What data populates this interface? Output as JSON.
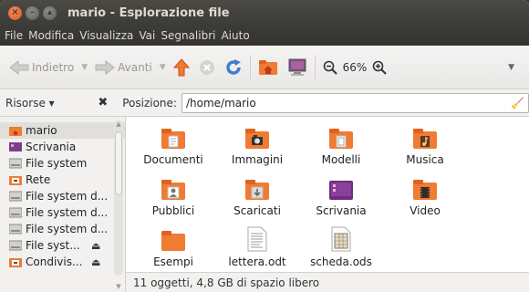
{
  "window": {
    "title": "mario - Esplorazione file"
  },
  "menubar": [
    "File",
    "Modifica",
    "Visualizza",
    "Vai",
    "Segnalibri",
    "Aiuto"
  ],
  "toolbar": {
    "back_label": "Indietro",
    "forward_label": "Avanti",
    "zoom_level": "66%"
  },
  "sidebar": {
    "header": "Risorse ▾",
    "items": [
      {
        "label": "mario",
        "icon": "home-folder-icon",
        "selected": true
      },
      {
        "label": "Scrivania",
        "icon": "desktop-icon"
      },
      {
        "label": "File system",
        "icon": "drive-icon"
      },
      {
        "label": "Rete",
        "icon": "network-icon"
      },
      {
        "label": "File system d...",
        "icon": "drive-icon"
      },
      {
        "label": "File system d...",
        "icon": "drive-icon"
      },
      {
        "label": "File system d...",
        "icon": "drive-icon"
      },
      {
        "label": "File syst...",
        "icon": "drive-icon",
        "eject": true
      },
      {
        "label": "Condivis...",
        "icon": "network-share-icon",
        "eject": true
      }
    ]
  },
  "location": {
    "label": "Posizione:",
    "path": "/home/mario"
  },
  "files": [
    {
      "name": "Documenti",
      "icon": "documents-folder-icon"
    },
    {
      "name": "Immagini",
      "icon": "pictures-folder-icon"
    },
    {
      "name": "Modelli",
      "icon": "templates-folder-icon"
    },
    {
      "name": "Musica",
      "icon": "music-folder-icon"
    },
    {
      "name": "Pubblici",
      "icon": "public-folder-icon"
    },
    {
      "name": "Scaricati",
      "icon": "downloads-folder-icon"
    },
    {
      "name": "Scrivania",
      "icon": "desktop-folder-icon"
    },
    {
      "name": "Video",
      "icon": "videos-folder-icon"
    },
    {
      "name": "Esempi",
      "icon": "folder-icon"
    },
    {
      "name": "lettera.odt",
      "icon": "text-document-icon"
    },
    {
      "name": "scheda.ods",
      "icon": "spreadsheet-icon"
    }
  ],
  "status": "11 oggetti, 4,8 GB di spazio libero",
  "colors": {
    "accent": "#e0531d",
    "folder_orange": "#f07b33",
    "titlebar": "#3c3b37"
  }
}
